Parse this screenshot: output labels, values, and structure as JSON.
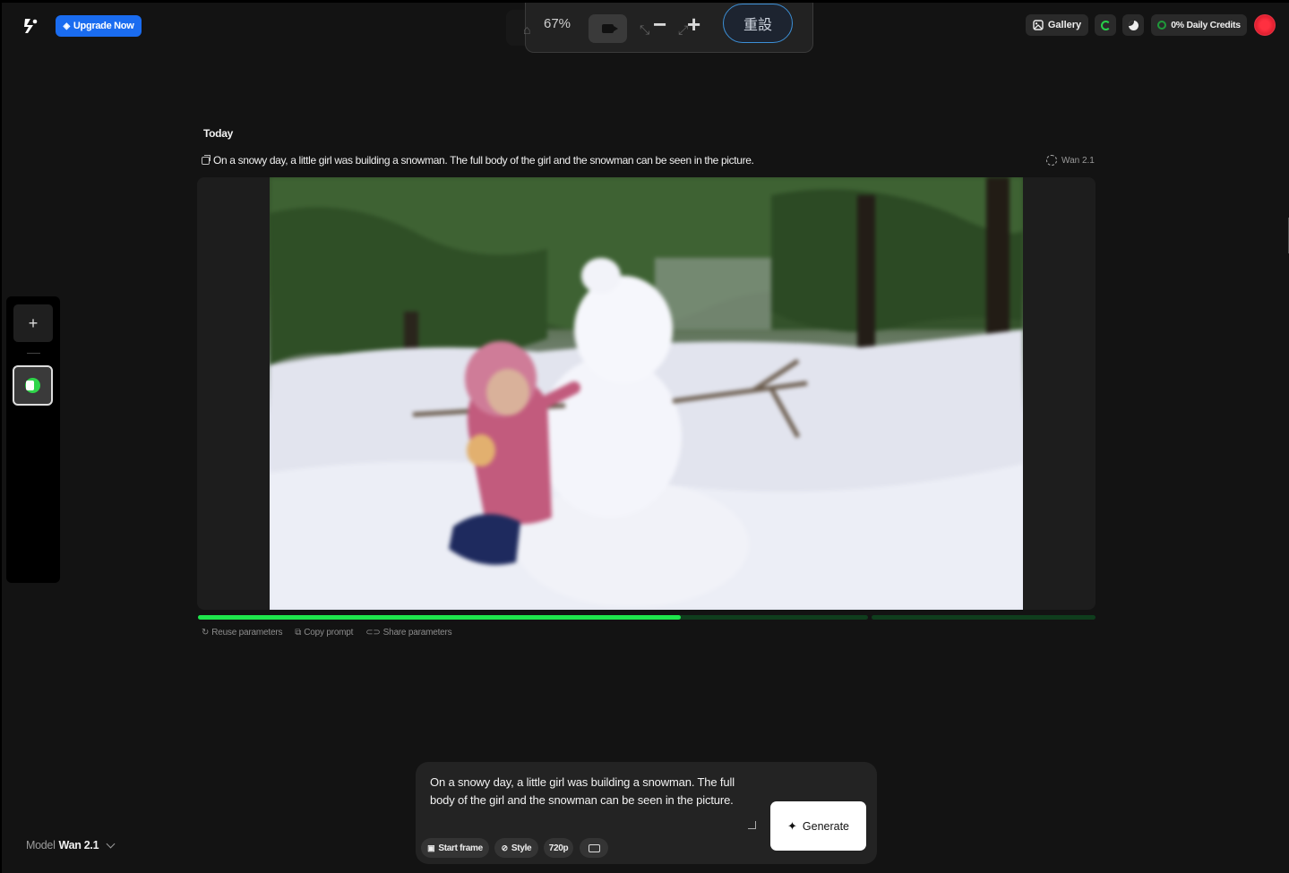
{
  "header": {
    "upgrade_label": "Upgrade Now",
    "zoom_percent": "67%",
    "reset_label": "重設",
    "gallery_label": "Gallery",
    "credits_label": "0% Daily Credits"
  },
  "feed": {
    "section_title": "Today",
    "prompt": "On a snowy day, a little girl was building a snowman. The full body of the girl and the snowman can be seen in the picture.",
    "model_tag": "Wan 2.1",
    "progress_fraction": 0.72,
    "actions": {
      "reuse": "Reuse parameters",
      "copy": "Copy prompt",
      "share": "Share parameters"
    }
  },
  "composer": {
    "text": "On a snowy day, a little girl was building a snowman. The full body of the girl and the snowman can be seen in the picture.",
    "generate_label": "Generate",
    "chips": {
      "start_frame": "Start frame",
      "style": "Style",
      "resolution": "720p"
    }
  },
  "model_select": {
    "label": "Model",
    "value": "Wan 2.1"
  },
  "colors": {
    "accent_blue": "#1a6cf0",
    "progress_green": "#1ee64c",
    "reset_outline": "#3c8fd6"
  }
}
